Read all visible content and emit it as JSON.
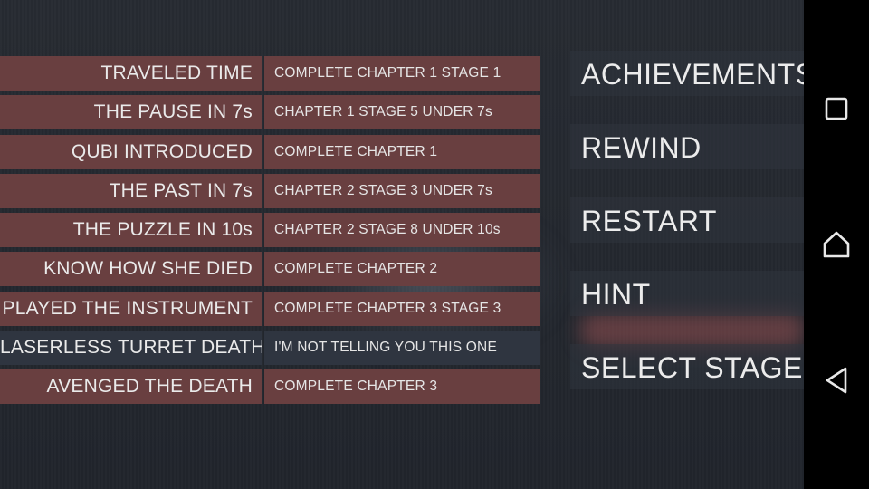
{
  "achievements": [
    {
      "name": "TRAVELED TIME",
      "desc": "COMPLETE CHAPTER 1 STAGE 1",
      "locked": false
    },
    {
      "name": "THE PAUSE IN 7s",
      "desc": "CHAPTER 1 STAGE 5 UNDER 7s",
      "locked": false
    },
    {
      "name": "QUBI INTRODUCED",
      "desc": "COMPLETE CHAPTER 1",
      "locked": false
    },
    {
      "name": "THE PAST IN 7s",
      "desc": "CHAPTER 2 STAGE 3 UNDER 7s",
      "locked": false
    },
    {
      "name": "THE PUZZLE IN 10s",
      "desc": "CHAPTER 2 STAGE 8 UNDER 10s",
      "locked": false
    },
    {
      "name": "KNOW HOW SHE DIED",
      "desc": "COMPLETE CHAPTER 2",
      "locked": false
    },
    {
      "name": "PLAYED THE INSTRUMENT",
      "desc": "COMPLETE CHAPTER 3 STAGE 3",
      "locked": false
    },
    {
      "name": "LASERLESS TURRET DEATH",
      "desc": "I'M NOT TELLING YOU THIS ONE",
      "locked": true
    },
    {
      "name": "AVENGED THE DEATH",
      "desc": "COMPLETE CHAPTER 3",
      "locked": false
    }
  ],
  "menu": {
    "achievements": "ACHIEVEMENTS",
    "rewind": "REWIND",
    "restart": "RESTART",
    "hint": "HINT",
    "select_stage": "SELECT STAGE"
  },
  "navbar": {
    "recents_icon": "square-recents-icon",
    "home_icon": "home-icon",
    "back_icon": "triangle-back-icon"
  },
  "colors": {
    "row_unlocked": "#693f40",
    "row_locked": "#2f3540",
    "background": "#22262d",
    "menu_item_bg": "#30353e",
    "text": "#ececec",
    "navbar": "#000000"
  }
}
